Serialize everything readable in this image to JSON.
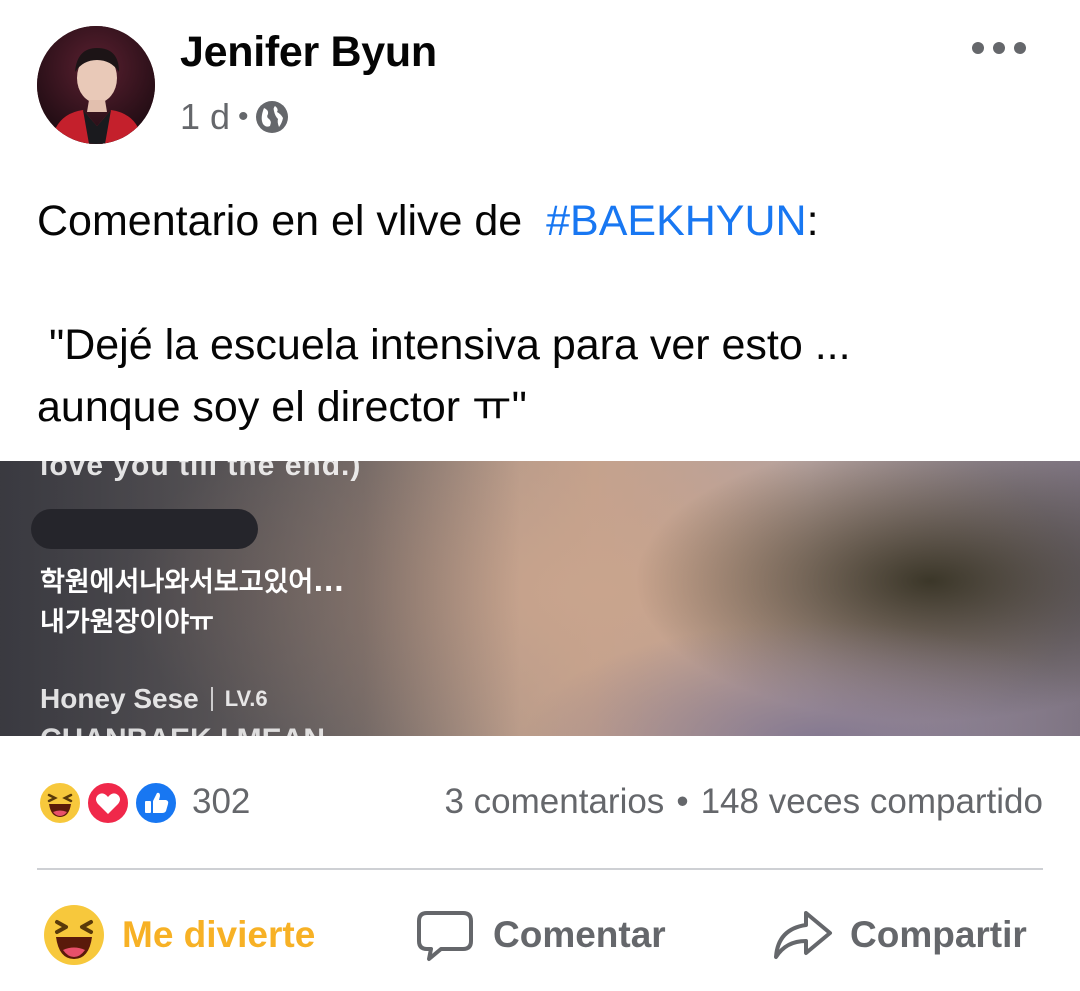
{
  "post": {
    "author": "Jenifer Byun",
    "time": "1 d",
    "meta_separator": "•",
    "privacy_icon": "globe-icon",
    "more_icon": "more-options-icon",
    "text_line1_prefix": "Comentario en el vlive de ",
    "hashtag": "#BAEKHYUN",
    "text_line1_suffix": ":",
    "quote_line1": " \"Dejé la escuela intensiva para ver esto ...",
    "quote_line2": "aunque soy el director ㅠ\""
  },
  "photo": {
    "top_text": "love you till the end.)",
    "comment_line1": "학원에서나와서보고있어...",
    "comment_line2": "내가원장이야ㅠ",
    "username": "Honey Sese",
    "level": "LV.6",
    "cut_text": "CHANBAEK I MEAN"
  },
  "stats": {
    "reaction_icons": [
      "haha-icon",
      "love-icon",
      "like-icon"
    ],
    "reaction_count": "302",
    "comments": "3 comentarios",
    "separator": "•",
    "shares": "148 veces compartido"
  },
  "actions": {
    "react_label": "Me divierte",
    "comment_label": "Comentar",
    "share_label": "Compartir"
  },
  "colors": {
    "hashtag": "#1877f2",
    "haha_active": "#f7b125",
    "secondary_text": "#65676b"
  }
}
